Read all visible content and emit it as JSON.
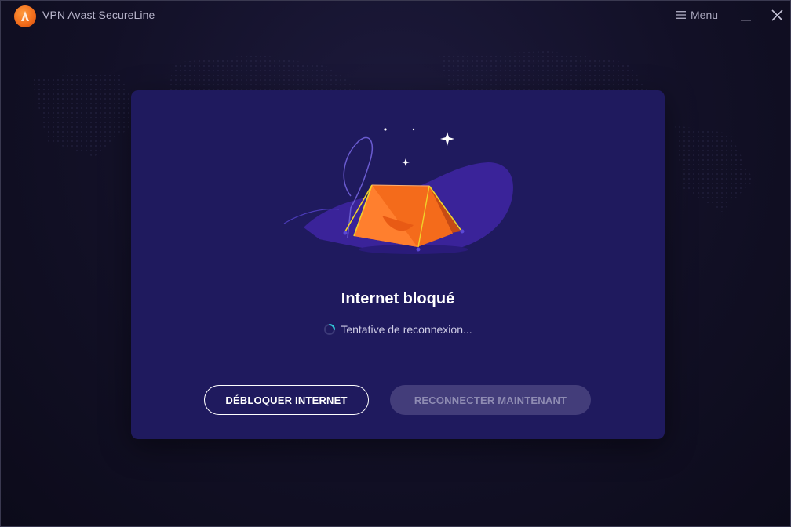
{
  "window": {
    "title": "VPN Avast SecureLine",
    "menu_label": "Menu"
  },
  "dialog": {
    "title": "Internet bloqué",
    "status_text": "Tentative de reconnexion...",
    "buttons": {
      "unblock_label": "DÉBLOQUER INTERNET",
      "reconnect_label": "RECONNECTER MAINTENANT"
    }
  },
  "icons": {
    "logo": "avast-logo-icon",
    "menu": "hamburger-menu-icon",
    "minimize": "minimize-icon",
    "close": "close-icon",
    "spinner": "loading-spinner-icon",
    "illustration": "tent-illustration"
  },
  "colors": {
    "background": "#121026",
    "dialog_bg": "#1f1a5e",
    "brand_orange": "#f06a1a",
    "button_disabled_bg": "#433d7a",
    "button_disabled_text": "#8f8cb3",
    "spinner_accent": "#2fc6d6"
  }
}
